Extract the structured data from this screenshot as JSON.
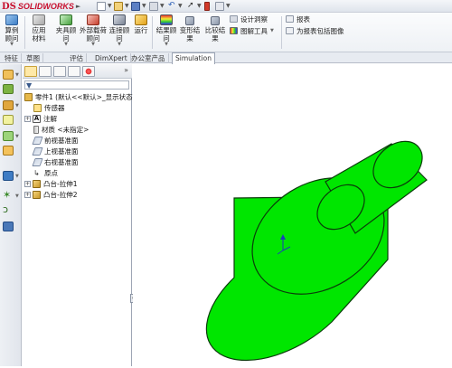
{
  "app": {
    "logo_mark": "DS",
    "logo_text": "SOLIDWORKS"
  },
  "ribbon": {
    "buttons": [
      {
        "label": "算例顾问",
        "icon": "study-advisor-icon"
      },
      {
        "label": "应用材料",
        "icon": "apply-material-icon"
      },
      {
        "label": "夹具顾问",
        "icon": "fixtures-advisor-icon"
      },
      {
        "label": "外部载荷顾问",
        "icon": "external-loads-advisor-icon"
      },
      {
        "label": "连接顾问",
        "icon": "connections-advisor-icon"
      },
      {
        "label": "运行",
        "icon": "run-icon"
      },
      {
        "label": "结果顾问",
        "icon": "results-advisor-icon"
      },
      {
        "label": "变形结果",
        "icon": "deformed-result-icon"
      },
      {
        "label": "比较结果",
        "icon": "compare-results-icon"
      }
    ],
    "side_items": {
      "design_insight": "设计洞察",
      "plot_tools": "图解工具",
      "report": "报表",
      "include_image": "为报表包括图像"
    }
  },
  "tabs": [
    "特征",
    "草图",
    "评估",
    "DimXpert",
    "办公室产品",
    "Simulation"
  ],
  "active_tab": "Simulation",
  "feature_tree": {
    "root": "零件1 (默认<<默认>_显示状态",
    "items": [
      {
        "label": "传感器",
        "icon": "sensor-icon",
        "expandable": false
      },
      {
        "label": "注解",
        "icon": "annotations-icon",
        "expandable": true
      },
      {
        "label": "材质 <未指定>",
        "icon": "material-icon",
        "expandable": false
      },
      {
        "label": "前视基准面",
        "icon": "plane-icon",
        "expandable": false
      },
      {
        "label": "上视基准面",
        "icon": "plane-icon",
        "expandable": false
      },
      {
        "label": "右视基准面",
        "icon": "plane-icon",
        "expandable": false
      },
      {
        "label": "原点",
        "icon": "origin-icon",
        "expandable": false
      },
      {
        "label": "凸台-拉伸1",
        "icon": "extrude-icon",
        "expandable": true
      },
      {
        "label": "凸台-拉伸2",
        "icon": "extrude-icon",
        "expandable": true
      }
    ]
  },
  "model": {
    "shape": "stepped cylinder",
    "color": "#00e600"
  },
  "colors": {
    "accent": "#c8102e",
    "model_green": "#00e600",
    "model_edge": "#0a3d0a"
  }
}
